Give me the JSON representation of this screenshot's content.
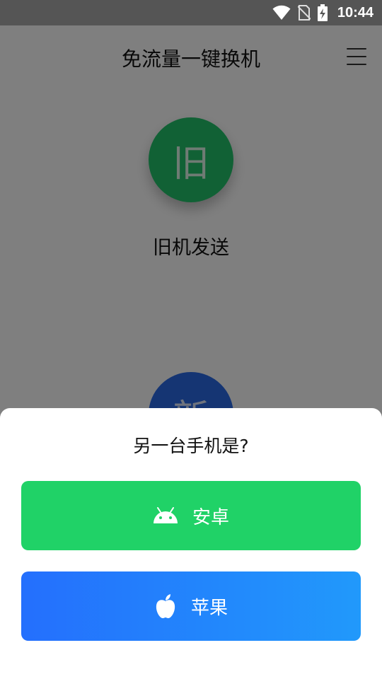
{
  "status_bar": {
    "time": "10:44",
    "icons": [
      "wifi-icon",
      "no-sim-icon",
      "battery-charging-icon"
    ]
  },
  "header": {
    "title": "免流量一键换机",
    "menu_icon": "hamburger-menu-icon"
  },
  "main": {
    "old_phone": {
      "circle_char": "旧",
      "label": "旧机发送",
      "color": "#22c36a"
    },
    "new_phone": {
      "circle_char": "新",
      "color": "#2b6be6"
    }
  },
  "sheet": {
    "title": "另一台手机是?",
    "options": [
      {
        "label": "安卓",
        "icon": "android-icon",
        "color": "#20d267"
      },
      {
        "label": "苹果",
        "icon": "apple-icon",
        "color": "#246ffd"
      }
    ]
  }
}
